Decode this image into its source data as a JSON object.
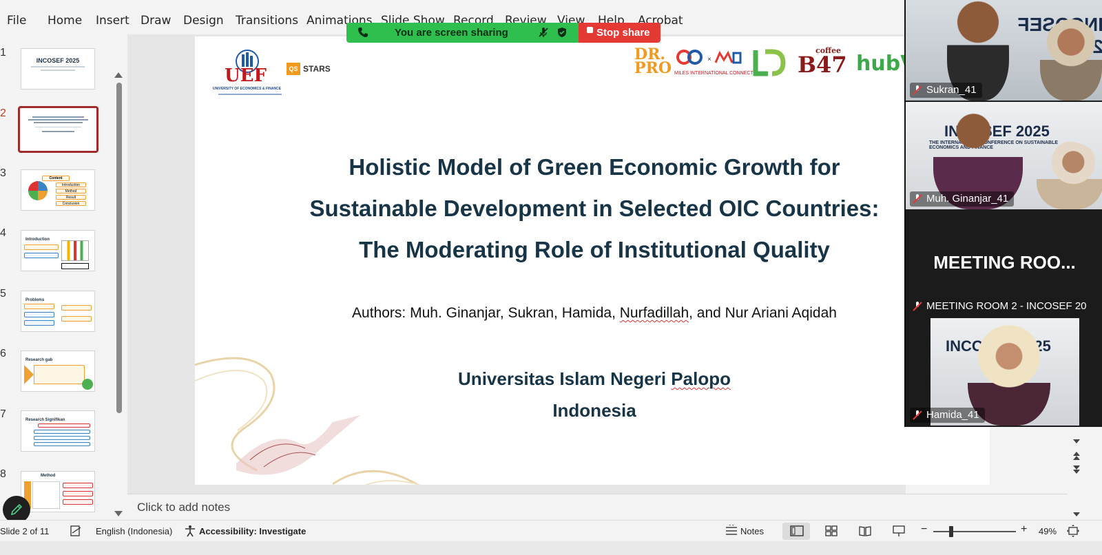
{
  "ribbon": {
    "tabs": [
      "File",
      "Home",
      "Insert",
      "Draw",
      "Design",
      "Transitions",
      "Animations",
      "Slide Show",
      "Record",
      "Review",
      "View",
      "Help",
      "Acrobat"
    ]
  },
  "share_bar": {
    "status_text": "You are screen sharing",
    "stop_label": "Stop share"
  },
  "thumbnails": {
    "numbers": [
      "1",
      "2",
      "3",
      "4",
      "5",
      "6",
      "7",
      "8"
    ],
    "slide1_title": "INCOSEF 2025",
    "slide3_labels": [
      "Content",
      "Introduction",
      "Method",
      "Result",
      "Conclusion"
    ],
    "slide4_header": "Introduction",
    "slide5_header": "Problems",
    "slide6_header": "Research gab",
    "slide7_header": "Research Signifikan",
    "slide8_header": "Method"
  },
  "slide": {
    "logo_uef": "UEF",
    "logo_uef_sub": "UNIVERSITY OF ECONOMICS & FINANCE",
    "logo_qs": "QS",
    "logo_stars": "STARS",
    "logo_drpro": "DR. PRO",
    "logo_miles": "MILES INTERNATIONAL CONNECT",
    "logo_coffee": "B47",
    "logo_coffee_top": "coffee",
    "logo_hub": "hubVi",
    "title_lines": [
      "Holistic Model of Green Economic Growth for",
      "Sustainable Development in Selected OIC Countries:",
      "The Moderating Role of Institutional Quality"
    ],
    "authors_prefix": "Authors: Muh. Ginanjar, Sukran, Hamida, ",
    "authors_squiggle": "Nurfadillah",
    "authors_suffix": ", and Nur Ariani Aqidah",
    "univ_prefix": "Universitas Islam Negeri ",
    "univ_squiggle": "Palopo",
    "country": "Indonesia"
  },
  "videos": {
    "tiles": [
      {
        "name": "Sukran_41"
      },
      {
        "name": "Muh. Ginanjar_41"
      },
      {
        "name": "MEETING ROOM 2 - INCOSEF 20"
      },
      {
        "name": "Hamida_41"
      }
    ],
    "meeting_big": "MEETING  ROO...",
    "banner_text": "INCOSEF 2025",
    "banner_sub": "THE INTERNATIONAL CONFERENCE ON SUSTAINABLE ECONOMICS AND FINANCE"
  },
  "notes": {
    "placeholder": "Click to add notes"
  },
  "status": {
    "slide_counter": "Slide 2 of 11",
    "language": "English (Indonesia)",
    "accessibility": "Accessibility: Investigate",
    "notes_label": "Notes",
    "zoom": "49%"
  },
  "colors": {
    "share_green": "#2fbf4f",
    "share_red": "#e53935",
    "title_color": "#183548",
    "active_thumb_border": "#9f2a2a",
    "active_video_border": "#2ecc71"
  }
}
